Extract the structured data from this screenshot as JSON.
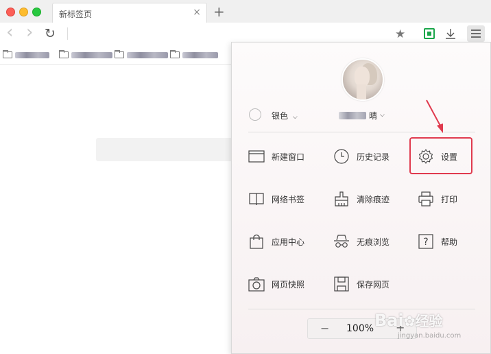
{
  "tab": {
    "title": "新标签页",
    "close_glyph": "×",
    "new_tab_glyph": "+"
  },
  "toolbar": {
    "back_glyph": "‹",
    "forward_glyph": "›",
    "reload_glyph": "↻",
    "bookmark_glyph": "★",
    "download_glyph": "⤓",
    "menu_glyph": "☰"
  },
  "menu": {
    "user": {
      "level": "银色",
      "name_suffix": "晴"
    },
    "items": [
      {
        "label": "新建窗口",
        "icon": "window-icon"
      },
      {
        "label": "历史记录",
        "icon": "clock-icon"
      },
      {
        "label": "设置",
        "icon": "gear-icon"
      },
      {
        "label": "网络书签",
        "icon": "book-icon"
      },
      {
        "label": "清除痕迹",
        "icon": "eraser-icon"
      },
      {
        "label": "打印",
        "icon": "printer-icon"
      },
      {
        "label": "应用中心",
        "icon": "bag-icon"
      },
      {
        "label": "无痕浏览",
        "icon": "incognito-icon"
      },
      {
        "label": "帮助",
        "icon": "help-icon"
      },
      {
        "label": "网页快照",
        "icon": "camera-icon"
      },
      {
        "label": "保存网页",
        "icon": "save-icon"
      }
    ],
    "zoom": {
      "minus": "−",
      "value": "100%",
      "plus": "+"
    }
  },
  "watermark": {
    "brand": "Bai",
    "brand_cn": "经验",
    "url": "jingyan.baidu.com"
  },
  "colors": {
    "highlight": "#e03a4e",
    "accent_green": "#1aa64a"
  }
}
